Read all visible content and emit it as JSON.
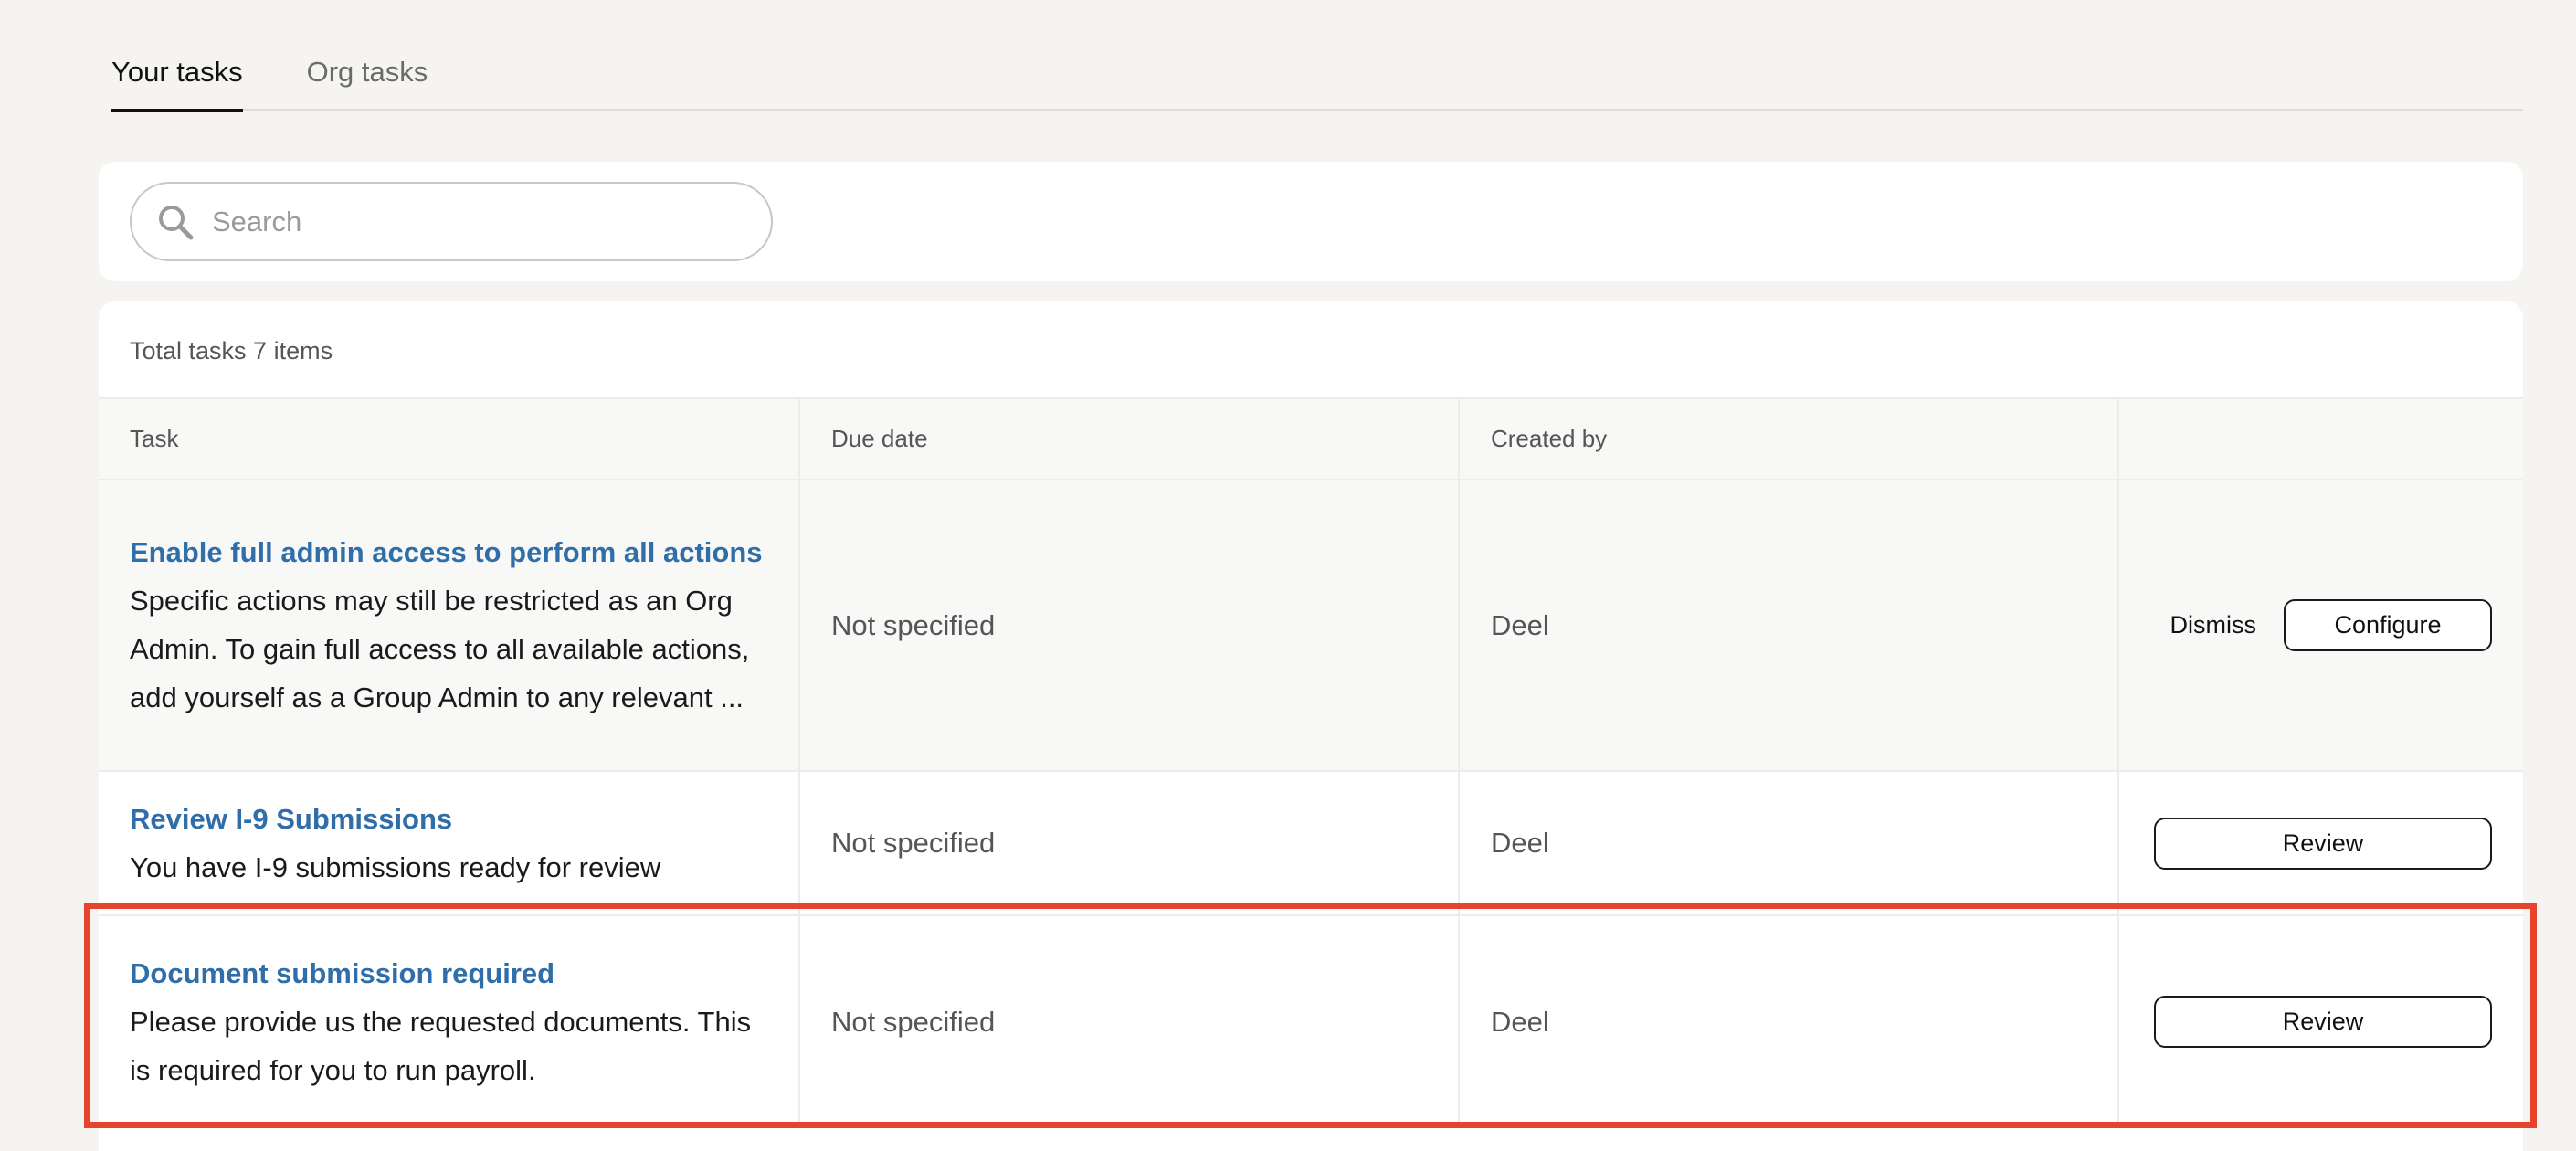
{
  "tabs": [
    {
      "label": "Your tasks",
      "active": true
    },
    {
      "label": "Org tasks",
      "active": false
    }
  ],
  "search": {
    "placeholder": "Search",
    "value": ""
  },
  "table": {
    "total_label": "Total tasks 7 items",
    "headers": {
      "task": "Task",
      "due_date": "Due date",
      "created_by": "Created by",
      "actions": ""
    },
    "rows": [
      {
        "title": "Enable full admin access to perform all actions",
        "description": "Specific actions may still be restricted as an Org Admin. To gain full access to all available actions, add yourself as a Group Admin to any relevant ...",
        "due_date": "Not specified",
        "created_by": "Deel",
        "secondary_action": "Dismiss",
        "primary_action": "Configure"
      },
      {
        "title": "Review I-9 Submissions",
        "description": "You have I-9 submissions ready for review",
        "due_date": "Not specified",
        "created_by": "Deel",
        "primary_action": "Review"
      },
      {
        "title": "Document submission required",
        "description": "Please provide us the requested documents. This is required for you to run payroll.",
        "due_date": "Not specified",
        "created_by": "Deel",
        "primary_action": "Review",
        "highlighted": true
      }
    ]
  },
  "colors": {
    "background": "#f5f4f0",
    "link": "#2f6ea8",
    "highlight": "#e8432c"
  }
}
